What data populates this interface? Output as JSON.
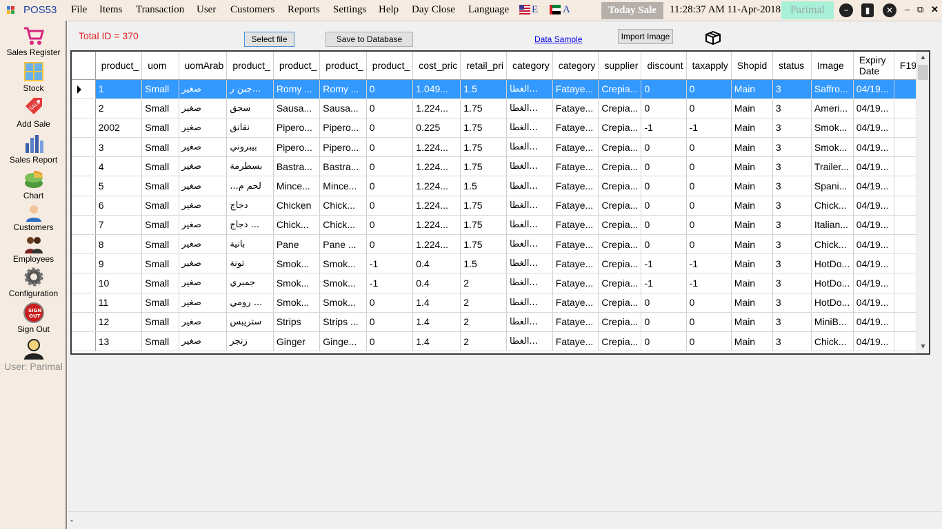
{
  "app": {
    "title": "POS53"
  },
  "menu": [
    "File",
    "Items",
    "Transaction",
    "User",
    "Customers",
    "Reports",
    "Settings",
    "Help",
    "Day Close",
    "Language"
  ],
  "languages": [
    {
      "label": "E",
      "icon": "us-flag-icon"
    },
    {
      "label": "A",
      "icon": "uae-flag-icon"
    }
  ],
  "topbar": {
    "today_sale": "Today Sale",
    "clock": "11:28:37 AM 11-Apr-2018",
    "user": "Parimal"
  },
  "sidebar": {
    "items": [
      {
        "label": "Sales Register",
        "icon": "shopping-cart-icon"
      },
      {
        "label": "Stock",
        "icon": "stock-boxes-icon"
      },
      {
        "label": "Add Sale",
        "icon": "sale-tag-icon"
      },
      {
        "label": "Sales Report",
        "icon": "bar-report-icon"
      },
      {
        "label": "Chart",
        "icon": "pie-chart-icon"
      },
      {
        "label": "Customers",
        "icon": "customer-icon"
      },
      {
        "label": "Employees",
        "icon": "employees-icon"
      },
      {
        "label": "Configuration",
        "icon": "gear-icon"
      },
      {
        "label": "Sign Out",
        "icon": "sign-out-icon"
      }
    ],
    "user_label": "User: Parimal"
  },
  "toolbar": {
    "total_id": "Total ID = 370",
    "select_file": "Select file",
    "save_db": "Save to Database",
    "data_sample": "Data Sample",
    "import_image": "Import  Image"
  },
  "grid": {
    "columns": [
      "product_",
      "uom",
      "uomArab",
      "product_",
      "product_",
      "product_",
      "product_",
      "cost_pric",
      "retail_pri",
      "category",
      "category",
      "supplier",
      "discount",
      "taxapply",
      "Shopid",
      "status",
      "Image",
      "Expiry Date",
      "F19"
    ],
    "rows": [
      [
        "1",
        "Small",
        "صغير",
        "...جبن ر",
        "Romy ...",
        "Romy ...",
        "0",
        "1.049...",
        "1.5",
        "...الغطا",
        "Fataye...",
        "Crepia...",
        "0",
        "0",
        "Main",
        "3",
        "Saffro...",
        "04/19...",
        ""
      ],
      [
        "2",
        "Small",
        "صغير",
        "سجق",
        "Sausa...",
        "Sausa...",
        "0",
        "1.224...",
        "1.75",
        "...الغطا",
        "Fataye...",
        "Crepia...",
        "0",
        "0",
        "Main",
        "3",
        "Ameri...",
        "04/19...",
        ""
      ],
      [
        "2002",
        "Small",
        "صغير",
        "نقانق",
        "Pipero...",
        "Pipero...",
        "0",
        "0.225",
        "1.75",
        "...الغطا",
        "Fataye...",
        "Crepia...",
        "-1",
        "-1",
        "Main",
        "3",
        "Smok...",
        "04/19...",
        ""
      ],
      [
        "3",
        "Small",
        "صغير",
        "بيبروني",
        "Pipero...",
        "Pipero...",
        "0",
        "1.224...",
        "1.75",
        "...الغطا",
        "Fataye...",
        "Crepia...",
        "0",
        "0",
        "Main",
        "3",
        "Smok...",
        "04/19...",
        ""
      ],
      [
        "4",
        "Small",
        "صغير",
        "بسطرمة",
        "Bastra...",
        "Bastra...",
        "0",
        "1.224...",
        "1.75",
        "...الغطا",
        "Fataye...",
        "Crepia...",
        "0",
        "0",
        "Main",
        "3",
        "Trailer...",
        "04/19...",
        ""
      ],
      [
        "5",
        "Small",
        "صغير",
        "لحم م...",
        "Mince...",
        "Mince...",
        "0",
        "1.224...",
        "1.5",
        "...الغطا",
        "Fataye...",
        "Crepia...",
        "0",
        "0",
        "Main",
        "3",
        "Spani...",
        "04/19...",
        ""
      ],
      [
        "6",
        "Small",
        "صغير",
        "دجاج",
        "Chicken",
        "Chick...",
        "0",
        "1.224...",
        "1.75",
        "...الغطا",
        "Fataye...",
        "Crepia...",
        "0",
        "0",
        "Main",
        "3",
        "Chick...",
        "04/19...",
        ""
      ],
      [
        "7",
        "Small",
        "صغير",
        "... دجاج",
        "Chick...",
        "Chick...",
        "0",
        "1.224...",
        "1.75",
        "...الغطا",
        "Fataye...",
        "Crepia...",
        "0",
        "0",
        "Main",
        "3",
        "Italian...",
        "04/19...",
        ""
      ],
      [
        "8",
        "Small",
        "صغير",
        "بانية",
        "Pane",
        "Pane ...",
        "0",
        "1.224...",
        "1.75",
        "...الغطا",
        "Fataye...",
        "Crepia...",
        "0",
        "0",
        "Main",
        "3",
        "Chick...",
        "04/19...",
        ""
      ],
      [
        "9",
        "Small",
        "صغير",
        "تونة",
        "Smok...",
        "Smok...",
        "-1",
        "0.4",
        "1.5",
        "...الغطا",
        "Fataye...",
        "Crepia...",
        "-1",
        "-1",
        "Main",
        "3",
        "HotDo...",
        "04/19...",
        ""
      ],
      [
        "10",
        "Small",
        "صغير",
        "جمبري",
        "Smok...",
        "Smok...",
        "-1",
        "0.4",
        "2",
        "...الغطا",
        "Fataye...",
        "Crepia...",
        "-1",
        "-1",
        "Main",
        "3",
        "HotDo...",
        "04/19...",
        ""
      ],
      [
        "11",
        "Small",
        "صغير",
        "... رومي",
        "Smok...",
        "Smok...",
        "0",
        "1.4",
        "2",
        "...الغطا",
        "Fataye...",
        "Crepia...",
        "0",
        "0",
        "Main",
        "3",
        "HotDo...",
        "04/19...",
        ""
      ],
      [
        "12",
        "Small",
        "صغير",
        "ستريبس",
        "Strips",
        "Strips ...",
        "0",
        "1.4",
        "2",
        "...الغطا",
        "Fataye...",
        "Crepia...",
        "0",
        "0",
        "Main",
        "3",
        "MiniB...",
        "04/19...",
        ""
      ],
      [
        "13",
        "Small",
        "صغير",
        "زنجر",
        "Ginger",
        "Ginge...",
        "0",
        "1.4",
        "2",
        "...الغطا",
        "Fataye...",
        "Crepia...",
        "0",
        "0",
        "Main",
        "3",
        "Chick...",
        "04/19...",
        ""
      ]
    ],
    "selected_row": 0
  },
  "status_bar": "-",
  "colors": {
    "accent": "#3399ff",
    "total_id": "#e02020",
    "title": "#1e3fa6",
    "user_badge": "#a8f0d8"
  }
}
